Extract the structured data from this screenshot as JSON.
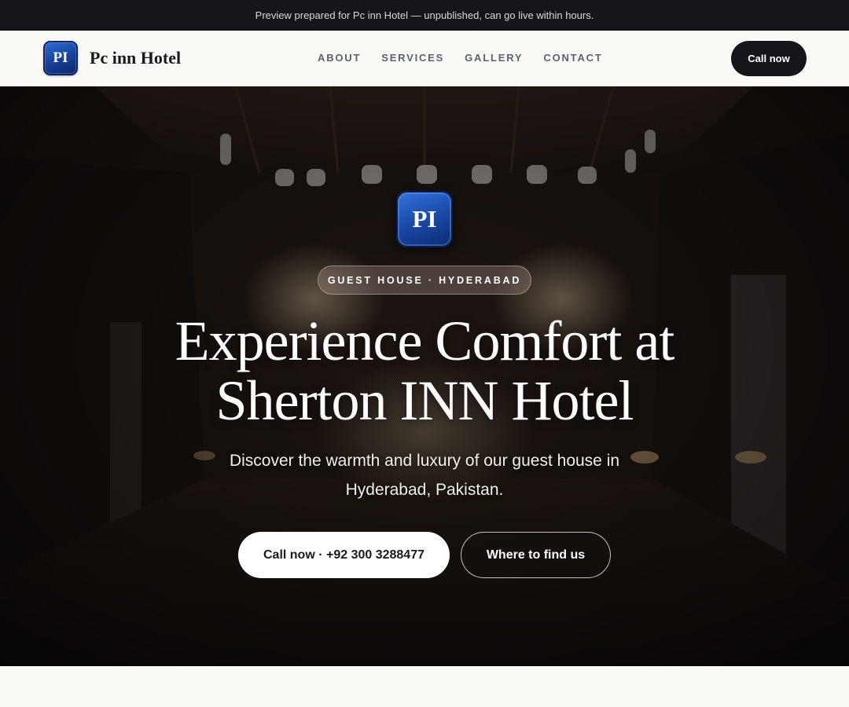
{
  "preview_banner": {
    "text": "Preview prepared for Pc inn Hotel — unpublished, can go live within hours."
  },
  "header": {
    "logo_initials": "PI",
    "brand_name": "Pc inn Hotel",
    "nav": [
      {
        "label": "ABOUT"
      },
      {
        "label": "SERVICES"
      },
      {
        "label": "GALLERY"
      },
      {
        "label": "CONTACT"
      }
    ],
    "cta_label": "Call now"
  },
  "hero": {
    "logo_initials": "PI",
    "eyebrow": "GUEST HOUSE · HYDERABAD",
    "title": "Experience Comfort at Sherton INN Hotel",
    "subtitle": "Discover the warmth and luxury of our guest house in Hyderabad, Pakistan.",
    "primary_button": "Call now · +92 300 3288477",
    "secondary_button": "Where to find us"
  },
  "colors": {
    "banner_bg": "#14161b",
    "header_bg": "#faf9f6",
    "logo_blue": "#1a4aa6",
    "cta_dark": "#14161c",
    "nav_text": "#5b6270"
  },
  "icons": [
    "hotel-lobby-photo"
  ]
}
